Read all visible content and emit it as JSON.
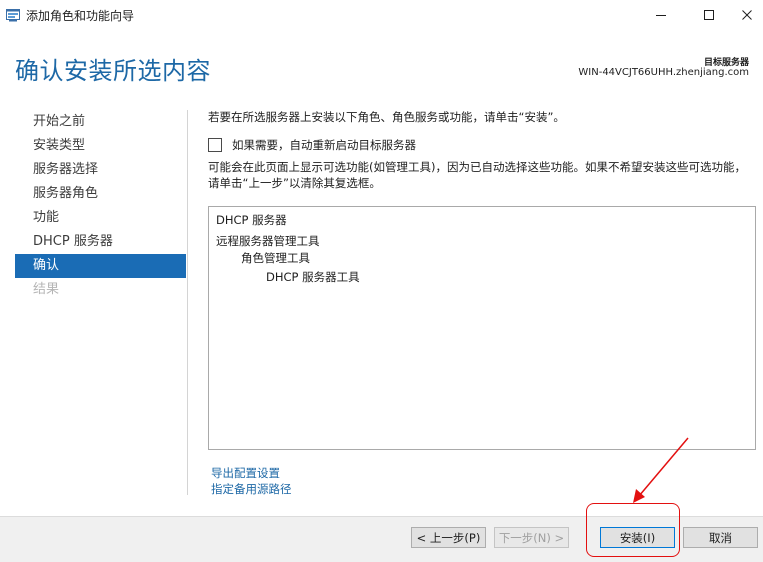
{
  "window": {
    "title": "添加角色和功能向导",
    "colors": {
      "accent": "#1a6cb5",
      "title_blue": "#1d68a6",
      "annotation_red": "#e31010"
    }
  },
  "header": {
    "page_title": "确认安装所选内容",
    "target_label": "目标服务器",
    "target_server": "WIN-44VCJT66UHH.zhenjiang.com"
  },
  "sidebar": {
    "items": [
      {
        "label": "开始之前",
        "state": "normal"
      },
      {
        "label": "安装类型",
        "state": "normal"
      },
      {
        "label": "服务器选择",
        "state": "normal"
      },
      {
        "label": "服务器角色",
        "state": "normal"
      },
      {
        "label": "功能",
        "state": "normal"
      },
      {
        "label": "DHCP 服务器",
        "state": "normal"
      },
      {
        "label": "确认",
        "state": "active"
      },
      {
        "label": "结果",
        "state": "disabled"
      }
    ]
  },
  "main": {
    "intro": "若要在所选服务器上安装以下角色、角色服务或功能，请单击“安装”。",
    "restart_checkbox": {
      "label": "如果需要，自动重新启动目标服务器",
      "checked": false
    },
    "note": "可能会在此页面上显示可选功能(如管理工具)，因为已自动选择这些功能。如果不希望安装这些可选功能，请单击“上一步”以清除其复选框。",
    "selection_list": [
      "DHCP 服务器",
      "远程服务器管理工具",
      "角色管理工具",
      "DHCP 服务器工具"
    ],
    "links": {
      "export": "导出配置设置",
      "alt_source": "指定备用源路径"
    }
  },
  "footer": {
    "prev": "< 上一步(P)",
    "next": "下一步(N) >",
    "install": "安装(I)",
    "cancel": "取消"
  },
  "icons": {
    "app": "wizard-app-icon",
    "minimize": "minimize-icon",
    "maximize": "maximize-icon",
    "close": "close-icon"
  }
}
